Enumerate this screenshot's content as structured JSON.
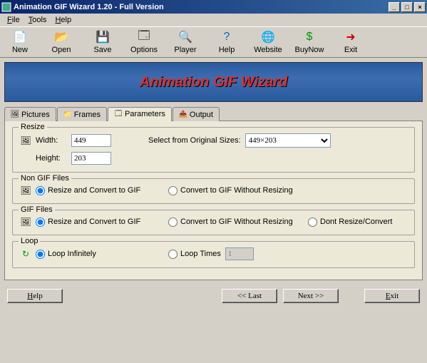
{
  "window": {
    "title": "Animation GIF Wizard 1.20 - Full Version"
  },
  "menu": {
    "file": "File",
    "tools": "Tools",
    "help": "Help"
  },
  "toolbar": {
    "new": "New",
    "open": "Open",
    "save": "Save",
    "options": "Options",
    "player": "Player",
    "help": "Help",
    "website": "Website",
    "buynow": "BuyNow",
    "exit": "Exit"
  },
  "banner": {
    "text": "Animation GIF Wizard"
  },
  "tabs": {
    "pictures": "Pictures",
    "frames": "Frames",
    "parameters": "Parameters",
    "output": "Output",
    "active": "parameters"
  },
  "resize": {
    "legend": "Resize",
    "width_label": "Width:",
    "width_value": "449",
    "height_label": "Height:",
    "height_value": "203",
    "select_label": "Select from Original Sizes:",
    "select_value": "449×203"
  },
  "nongif": {
    "legend": "Non GIF Files",
    "opt1": "Resize and Convert to GIF",
    "opt2": "Convert to GIF Without Resizing",
    "selected": "opt1"
  },
  "gif": {
    "legend": "GIF Files",
    "opt1": "Resize and Convert to GIF",
    "opt2": "Convert to GIF Without Resizing",
    "opt3": "Dont Resize/Convert",
    "selected": "opt1"
  },
  "loop": {
    "legend": "Loop",
    "opt1": "Loop Infinitely",
    "opt2": "Loop Times",
    "times_value": "1",
    "selected": "opt1"
  },
  "footer": {
    "help": "Help",
    "last": "<<  Last",
    "next": "Next  >>",
    "exit": "Exit"
  }
}
